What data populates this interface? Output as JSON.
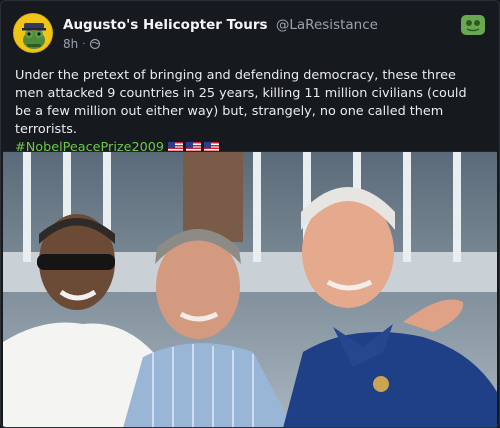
{
  "post": {
    "display_name": "Augusto's Helicopter Tours",
    "handle": "@LaResistance",
    "timestamp": "8h",
    "body_text": "Under the pretext of bringing and defending democracy, these three men attacked 9 countries in 25 years, killing 11 million civilians (could be a few million out either way) but, strangely, no one called them terrorists.",
    "hashtag": "#NobelPeacePrize2009",
    "flag_icons": [
      "us-flag-icon",
      "us-flag-icon",
      "us-flag-icon"
    ],
    "accent_color": "#6ec84a"
  }
}
